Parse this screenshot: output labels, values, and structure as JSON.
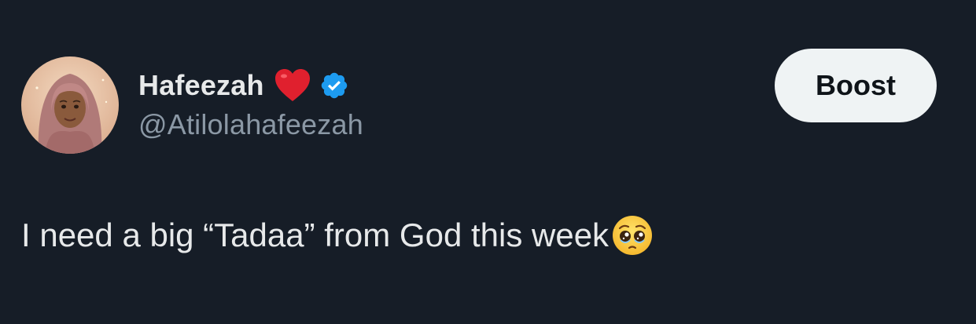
{
  "author": {
    "display_name": "Hafeezah",
    "handle": "@Atilolahafeezah",
    "name_emoji": "red-heart-icon",
    "verified": true,
    "verified_color": "#1d9bf0",
    "avatar": "avatar-illustration-hijab"
  },
  "actions": {
    "boost_label": "Boost"
  },
  "tweet": {
    "text": "I need a big “Tadaa” from God this week",
    "trailing_emoji": "pleading-face-icon"
  },
  "colors": {
    "background": "#161d27",
    "text_primary": "#e7e9ea",
    "text_secondary": "#8b98a5",
    "button_bg": "#eff3f4",
    "heart": "#e0202e"
  }
}
